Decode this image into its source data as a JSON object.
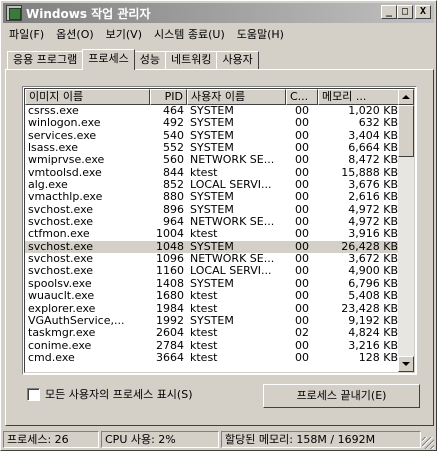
{
  "window": {
    "title": "Windows 작업 관리자",
    "controls": [
      "_",
      "□",
      "X"
    ]
  },
  "menu": [
    "파일(F)",
    "옵션(O)",
    "보기(V)",
    "시스템 종료(U)",
    "도움말(H)"
  ],
  "tabs": [
    "응용 프로그램",
    "프로세스",
    "성능",
    "네트워킹",
    "사용자"
  ],
  "active_tab": "프로세스",
  "columns": [
    "이미지 이름",
    "PID",
    "사용자 이름",
    "C...",
    "메모리 ..."
  ],
  "processes": [
    {
      "name": "csrss.exe",
      "pid": "464",
      "user": "SYSTEM",
      "cpu": "00",
      "mem": "1,020 KB"
    },
    {
      "name": "winlogon.exe",
      "pid": "492",
      "user": "SYSTEM",
      "cpu": "00",
      "mem": "632 KB"
    },
    {
      "name": "services.exe",
      "pid": "540",
      "user": "SYSTEM",
      "cpu": "00",
      "mem": "3,404 KB"
    },
    {
      "name": "lsass.exe",
      "pid": "552",
      "user": "SYSTEM",
      "cpu": "00",
      "mem": "6,664 KB"
    },
    {
      "name": "wmiprvse.exe",
      "pid": "560",
      "user": "NETWORK SE...",
      "cpu": "00",
      "mem": "8,472 KB"
    },
    {
      "name": "vmtoolsd.exe",
      "pid": "844",
      "user": "ktest",
      "cpu": "00",
      "mem": "15,888 KB"
    },
    {
      "name": "alg.exe",
      "pid": "852",
      "user": "LOCAL SERVI...",
      "cpu": "00",
      "mem": "3,676 KB"
    },
    {
      "name": "vmacthlp.exe",
      "pid": "880",
      "user": "SYSTEM",
      "cpu": "00",
      "mem": "2,616 KB"
    },
    {
      "name": "svchost.exe",
      "pid": "896",
      "user": "SYSTEM",
      "cpu": "00",
      "mem": "4,972 KB"
    },
    {
      "name": "svchost.exe",
      "pid": "964",
      "user": "NETWORK SE...",
      "cpu": "00",
      "mem": "4,972 KB"
    },
    {
      "name": "ctfmon.exe",
      "pid": "1004",
      "user": "ktest",
      "cpu": "00",
      "mem": "3,916 KB"
    },
    {
      "name": "svchost.exe",
      "pid": "1048",
      "user": "SYSTEM",
      "cpu": "00",
      "mem": "26,428 KB"
    },
    {
      "name": "svchost.exe",
      "pid": "1096",
      "user": "NETWORK SE...",
      "cpu": "00",
      "mem": "3,672 KB"
    },
    {
      "name": "svchost.exe",
      "pid": "1160",
      "user": "LOCAL SERVI...",
      "cpu": "00",
      "mem": "4,900 KB"
    },
    {
      "name": "spoolsv.exe",
      "pid": "1408",
      "user": "SYSTEM",
      "cpu": "00",
      "mem": "6,796 KB"
    },
    {
      "name": "wuauclt.exe",
      "pid": "1680",
      "user": "ktest",
      "cpu": "00",
      "mem": "5,408 KB"
    },
    {
      "name": "explorer.exe",
      "pid": "1984",
      "user": "ktest",
      "cpu": "00",
      "mem": "23,428 KB"
    },
    {
      "name": "VGAuthService,...",
      "pid": "1992",
      "user": "SYSTEM",
      "cpu": "00",
      "mem": "9,192 KB"
    },
    {
      "name": "taskmgr.exe",
      "pid": "2604",
      "user": "ktest",
      "cpu": "02",
      "mem": "4,824 KB"
    },
    {
      "name": "conime.exe",
      "pid": "2784",
      "user": "ktest",
      "cpu": "00",
      "mem": "3,216 KB"
    },
    {
      "name": "cmd.exe",
      "pid": "3664",
      "user": "ktest",
      "cpu": "00",
      "mem": "128 KB"
    }
  ],
  "selected_row": 11,
  "show_all_label": "모든 사용자의 프로세스 표시(S)",
  "show_all_checked": false,
  "end_process_label": "프로세스 끝내기(E)",
  "status": {
    "processes": "프로세스: 26",
    "cpu": "CPU 사용: 2%",
    "memory": "할당된 메모리: 158M / 1692M"
  }
}
